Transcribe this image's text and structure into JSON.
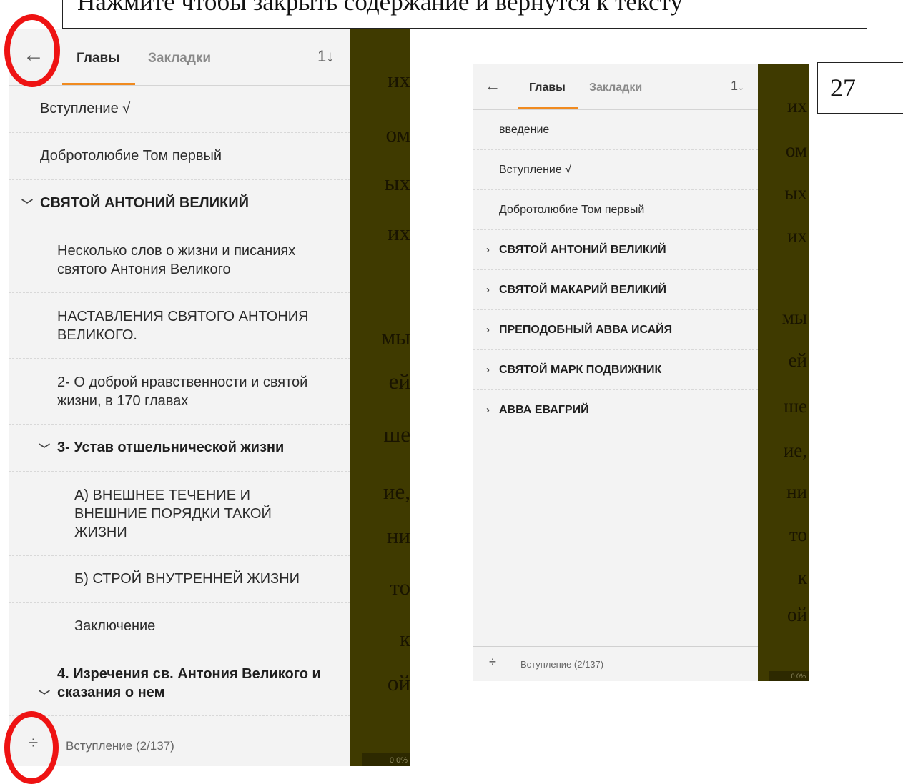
{
  "caption": {
    "text": "Нажмите чтобы закрыть содержание и вернутся к тексту"
  },
  "page_number": "27",
  "left": {
    "tabs": {
      "chapters": "Главы",
      "bookmarks": "Закладки"
    },
    "sort_icon": "1↓",
    "items": [
      "Вступление √",
      "Добротолюбие Том первый",
      "СВЯТОЙ АНТОНИЙ ВЕЛИКИЙ",
      "Несколько слов о жизни и писаниях святого Антония Великого",
      "НАСТАВЛЕНИЯ СВЯТОГО АНТОНИЯ ВЕЛИКОГО.",
      "2- О доброй нравственности и святой жизни, в 170 главах",
      "3- Устав отшельнической жизни",
      "А) ВНЕШНЕЕ ТЕЧЕНИЕ И ВНЕШНИЕ ПОРЯДКИ ТАКОЙ ЖИЗНИ",
      "Б) СТРОЙ ВНУТРЕННЕЙ ЖИЗНИ",
      "Заключение",
      "4. Изречения св. Антония Великого и сказания о нем"
    ],
    "footer": "Вступление (2/137)",
    "book_words": [
      "их",
      "ом",
      "ых",
      "их",
      "мы",
      "ей",
      "ше",
      "ие,",
      "ни",
      "то",
      "к",
      "ой"
    ],
    "progress": "0.0%"
  },
  "right": {
    "tabs": {
      "chapters": "Главы",
      "bookmarks": "Закладки"
    },
    "sort_icon": "1↓",
    "items": [
      "введение",
      "Вступление √",
      "Добротолюбие Том первый",
      "СВЯТОЙ АНТОНИЙ ВЕЛИКИЙ",
      "СВЯТОЙ МАКАРИЙ ВЕЛИКИЙ",
      "ПРЕПОДОБНЫЙ АВВА ИСАЙЯ",
      "СВЯТОЙ МАРК ПОДВИЖНИК",
      "АВВА ЕВАГРИЙ"
    ],
    "footer": "Вступление (2/137)",
    "book_words": [
      "их",
      "ом",
      "ых",
      "их",
      "мы",
      "ей",
      "ше",
      "ие,",
      "ни",
      "то",
      "к",
      "ой"
    ],
    "progress": "0.0%"
  },
  "colors": {
    "accent": "#f08a1f",
    "book_bg": "#3f3a00",
    "highlight": "#ee1313"
  }
}
